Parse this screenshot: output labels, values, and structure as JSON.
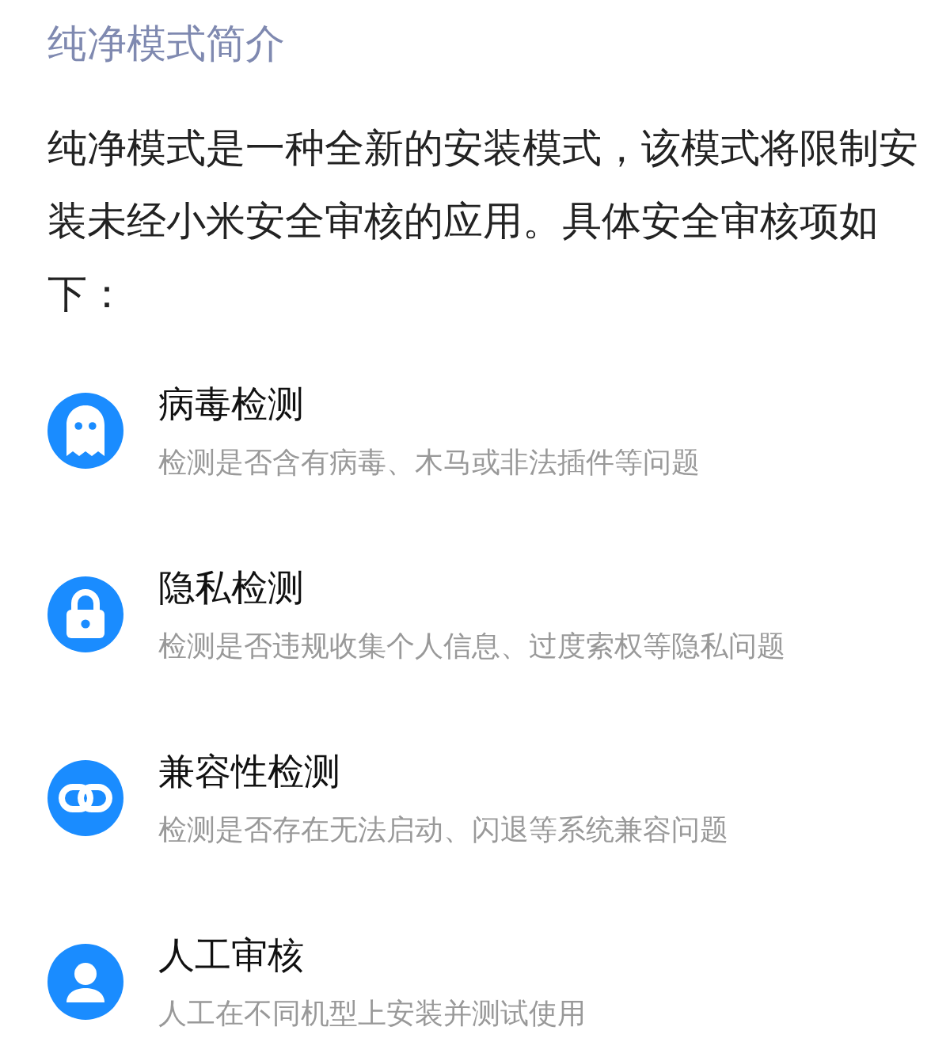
{
  "title": "纯净模式简介",
  "intro": "纯净模式是一种全新的安装模式，该模式将限制安装未经小米安全审核的应用。具体安全审核项如下：",
  "items": [
    {
      "kind": "ghost",
      "title": "病毒检测",
      "description": "检测是否含有病毒、木马或非法插件等问题"
    },
    {
      "kind": "lock",
      "title": "隐私检测",
      "description": "检测是否违规收集个人信息、过度索权等隐私问题"
    },
    {
      "kind": "link",
      "title": "兼容性检测",
      "description": "检测是否存在无法启动、闪退等系统兼容问题"
    },
    {
      "kind": "person",
      "title": "人工审核",
      "description": "人工在不同机型上安装并测试使用"
    }
  ]
}
